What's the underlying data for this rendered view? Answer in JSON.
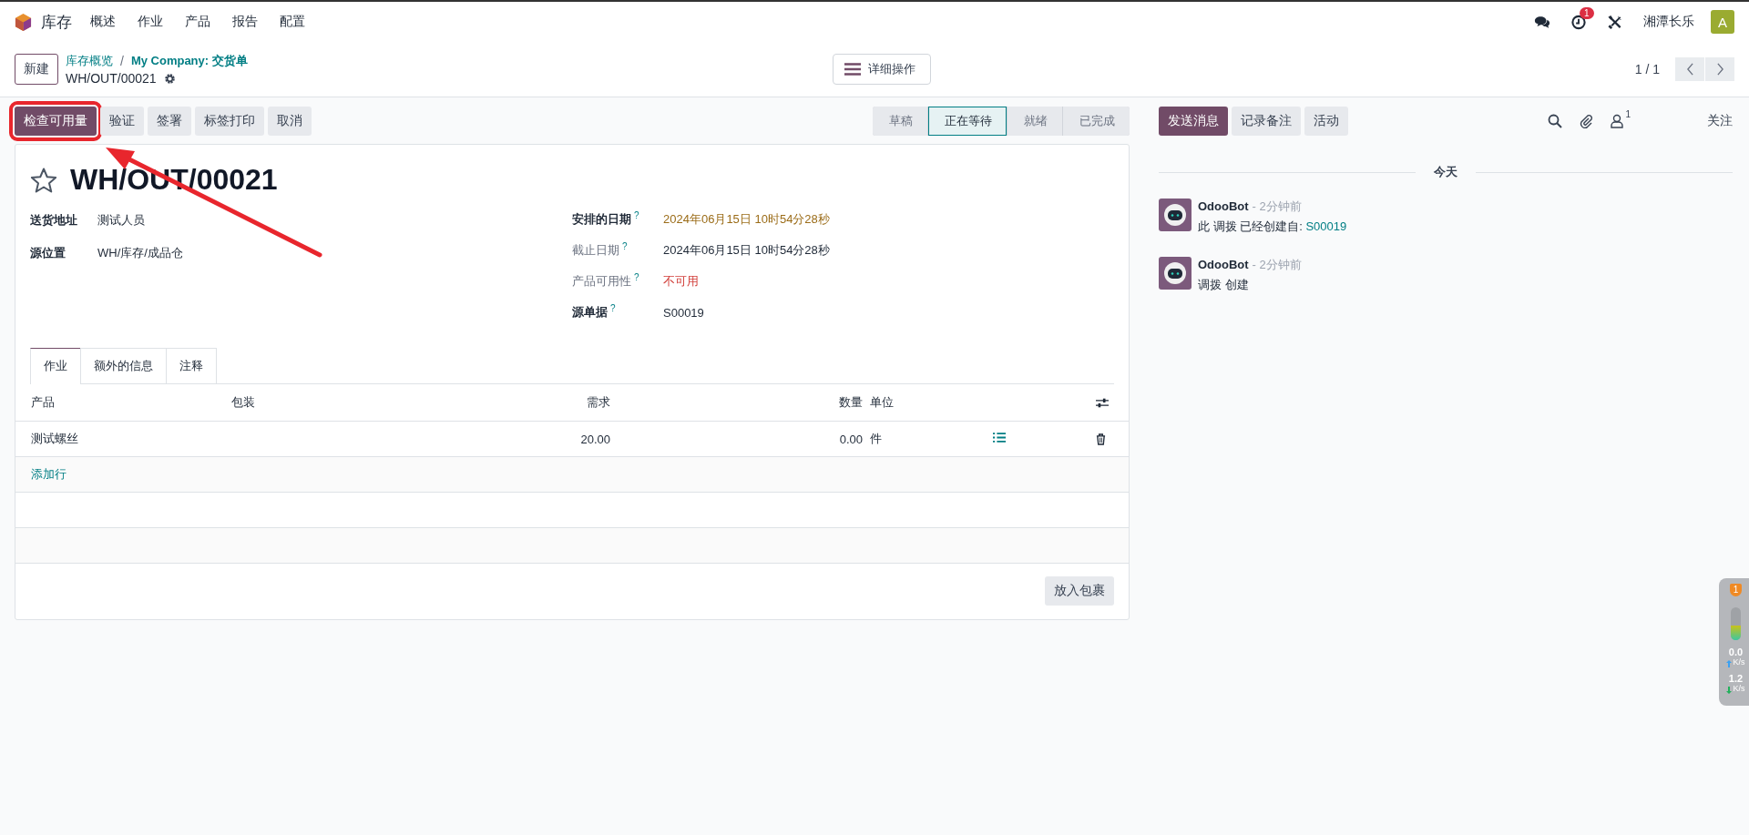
{
  "navbar": {
    "app_name": "库存",
    "menu": [
      "概述",
      "作业",
      "产品",
      "报告",
      "配置"
    ],
    "activity_count": "1",
    "company": "湘潭长乐",
    "avatar_letter": "A"
  },
  "control_panel": {
    "new_button": "新建",
    "breadcrumbs": [
      "库存概览",
      "My Company: 交货单"
    ],
    "breadcrumb_separator": "/",
    "record_name": "WH/OUT/00021",
    "actions_button": "详细操作",
    "pager": "1 / 1"
  },
  "buttons": [
    {
      "label": "检查可用量",
      "primary": true,
      "highlighted": true
    },
    {
      "label": "验证",
      "primary": false,
      "highlighted": false
    },
    {
      "label": "签署",
      "primary": false,
      "highlighted": false
    },
    {
      "label": "标签打印",
      "primary": false,
      "highlighted": false
    },
    {
      "label": "取消",
      "primary": false,
      "highlighted": false
    }
  ],
  "annotation_arrow": true,
  "status_steps": [
    {
      "label": "草稿",
      "selected": false
    },
    {
      "label": "正在等待",
      "selected": true
    },
    {
      "label": "就绪",
      "selected": false
    },
    {
      "label": "已完成",
      "selected": false
    }
  ],
  "record": {
    "title": "WH/OUT/00021",
    "starred": false,
    "left_fields": [
      {
        "label": "送货地址",
        "value": "测试人员"
      },
      {
        "label": "源位置",
        "value": "WH/库存/成品仓"
      }
    ],
    "right_fields": [
      {
        "label": "安排的日期",
        "help": "?",
        "emphasis": true,
        "value": "2024年06月15日 10时54分28秒",
        "color": "#9b6c18"
      },
      {
        "label": "截止日期",
        "help": "?",
        "emphasis": false,
        "value": "2024年06月15日 10时54分28秒",
        "color": "#1f2937"
      },
      {
        "label": "产品可用性",
        "help": "?",
        "emphasis": false,
        "value": "不可用",
        "color": "#d23f3a"
      },
      {
        "label": "源单据",
        "help": "?",
        "emphasis": true,
        "value": "S00019",
        "color": "#1f2937"
      }
    ]
  },
  "tabs": [
    {
      "label": "作业",
      "selected": true
    },
    {
      "label": "额外的信息",
      "selected": false
    },
    {
      "label": "注释",
      "selected": false
    }
  ],
  "table": {
    "columns": [
      "产品",
      "包装",
      "需求",
      "数量",
      "单位"
    ],
    "rows": [
      {
        "product": "测试螺丝",
        "demand": "20.00",
        "quantity": "0.00",
        "unit": "件"
      }
    ],
    "add_line": "添加行"
  },
  "put_in_pack": "放入包裹",
  "chatter": {
    "buttons": [
      {
        "label": "发送消息",
        "primary": true
      },
      {
        "label": "记录备注",
        "primary": false
      },
      {
        "label": "活动",
        "primary": false
      }
    ],
    "follower_count": "1",
    "follow": "关注",
    "date_divider": "今天",
    "messages": [
      {
        "author": "OdooBot",
        "time": "- 2分钟前",
        "body": "此 调拨 已经创建自: ",
        "link": "S00019"
      },
      {
        "author": "OdooBot",
        "time": "- 2分钟前",
        "body": "调拨 创建"
      }
    ]
  },
  "speed_widget": {
    "badge": "1",
    "level": 0.45,
    "upload": "0.0",
    "upload_unit": "K/s",
    "download": "1.2",
    "download_unit": "K/s"
  }
}
